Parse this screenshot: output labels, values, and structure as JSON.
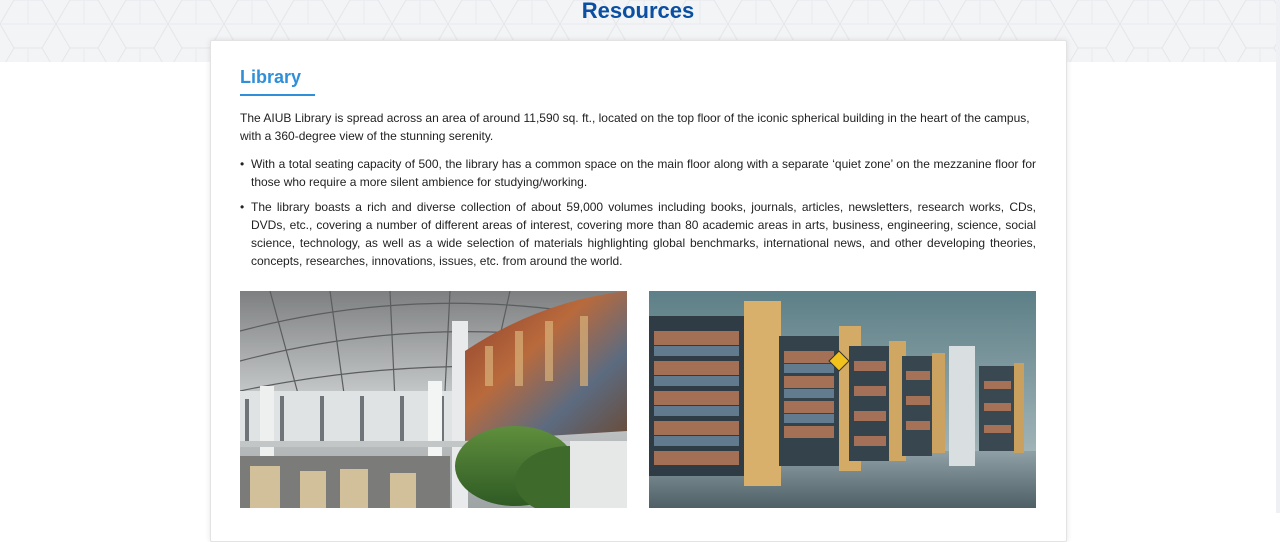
{
  "page": {
    "title": "Resources"
  },
  "library": {
    "heading": "Library",
    "intro": "The AIUB Library is spread across an area of around 11,590 sq. ft., located on the top floor of the iconic spherical building in the heart of the campus, with a 360-degree view of the stunning serenity.",
    "bullets": [
      "With a total seating capacity of 500, the library has a common space on the main floor along with a separate ‘quiet zone’ on the mezzanine floor for those who require a more silent ambience for studying/working.",
      "The library boasts a rich and diverse collection of about 59,000 volumes including books, journals, articles, newsletters, research works, CDs, DVDs, etc., covering a number of different areas of interest, covering more than 80 academic areas in arts, business, engineering, science, social science, technology, as well as a wide selection of materials highlighting global benchmarks, international news, and other developing theories, concepts, researches, innovations, issues, etc. from around the world."
    ],
    "bullet_glyph": "•",
    "photos": [
      {
        "icon": "library-dome-photo"
      },
      {
        "icon": "library-bookshelves-photo"
      }
    ]
  },
  "colors": {
    "title": "#0b4fa3",
    "heading": "#2f8fd8",
    "text": "#222222"
  }
}
